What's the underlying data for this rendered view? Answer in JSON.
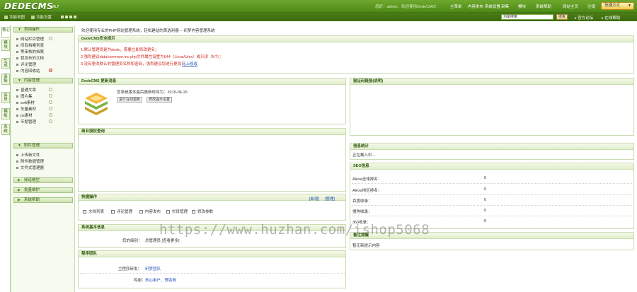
{
  "header": {
    "logo": "DEDECMS",
    "version": "V5.7",
    "user_info": "您好：admin，欢迎使用DedeCMS！",
    "nav": [
      "主菜单",
      "内容发布",
      "系统设置",
      "采集",
      "模块",
      "系统帮助",
      "网站主页",
      "注销"
    ],
    "quick_label": "快捷方式",
    "quick_arrow": "▼"
  },
  "subbar": {
    "items": [
      "功能地图",
      "功能设置"
    ],
    "search_value": "功能搜索",
    "search_button": "搜索",
    "links": [
      "官方论坛",
      "在线帮助"
    ]
  },
  "vtabs": [
    "核心",
    "模块",
    "生成",
    "采集",
    "会员",
    "模板",
    "系统"
  ],
  "leftmenu": {
    "groups": [
      {
        "title": "常用操作",
        "items": [
          "网站栏目管理",
          "所有档案列表",
          "等审核的档案",
          "我发布的文档",
          "评论管理",
          "内容回收站"
        ]
      },
      {
        "title": "内容管理",
        "items": [
          "普通文章",
          "图片集",
          "soft素材",
          "矢量素材",
          "ps素材",
          "专题管理"
        ]
      },
      {
        "title": "附件管理",
        "items": [
          "上传新文件",
          "附件数据管理",
          "文件式管理器"
        ]
      },
      {
        "title": "频道模型",
        "items": []
      },
      {
        "title": "批量维护",
        "items": []
      },
      {
        "title": "系统帮助",
        "items": []
      }
    ]
  },
  "main": {
    "welcome": "欢迎使用专业的PHP网站管理系统，轻松建站的首选利器 -- 织梦内容管理系统",
    "security": {
      "title": "DedeCMS安全提示",
      "lines": [
        "1.默认管理员是为dede，需要立即修改更名；",
        "2.强烈建议data/common.inc.php文件属性设置为644（Linux/Unix）或只读（NT）；",
        "3.没有更改默认的管理员名称和密码，强烈建议您进行更改！"
      ],
      "link": "马上修改"
    },
    "update": {
      "title": "DedeCMS 更新消息",
      "text": "您系统版本最后更新时间为：2015-06-15",
      "btn1": "进行在线更新",
      "btn2": "修改提示设置"
    },
    "links_title": "验证码链接(说明)",
    "biz_title": "商业授权查询",
    "stats": {
      "title": "信息统计",
      "text": "正在载入中..."
    },
    "seo": {
      "title": "SEO信息",
      "rows": [
        {
          "label": "Alexa全球排名：",
          "value": "0"
        },
        {
          "label": "Alexa地区排名：",
          "value": "0"
        },
        {
          "label": "百度收录：",
          "value": "0"
        },
        {
          "label": "搜狗收录：",
          "value": "0"
        },
        {
          "label": "360收录：",
          "value": "0"
        }
      ]
    },
    "quick_ops": {
      "title": "快捷操作",
      "new": "[新增]",
      "manage": "[管理]",
      "items": [
        "文档列表",
        "评论管理",
        "内容发布",
        "栏目管理",
        "修改参数"
      ]
    },
    "sysinfo": {
      "title": "系统基本信息",
      "label": "您的级别：",
      "value": "总管理员 [查看更多]"
    },
    "notes": {
      "title": "备注提醒",
      "text": "暂无新提示内容"
    },
    "team": {
      "title": "程序团队",
      "rows": [
        {
          "label": "主程序研发：",
          "value": "织梦团队"
        },
        {
          "label": "鸣谢：",
          "value": "热心用户、赞助商"
        }
      ]
    }
  },
  "watermark": "https://www.huzhan.com/ishop5068",
  "colors": {
    "brand_green": "#4d8a17",
    "panel_border": "#c9dcb3",
    "warn_red": "#cc2b1d"
  }
}
